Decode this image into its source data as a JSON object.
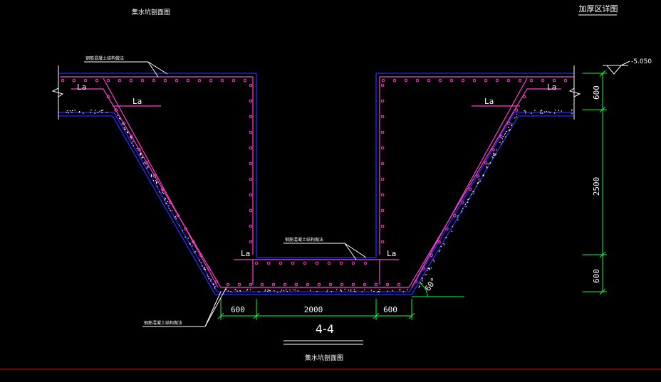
{
  "drawing": {
    "top_title": "集水坑剖面图",
    "corner_title": "加厚区详图",
    "section_label": "4-4",
    "bottom_title": "集水坑剖面图",
    "elevation": "-5.050",
    "callout_top": "钢筋混凝土结构做法",
    "callout_mid": "钢筋混凝土结构做法",
    "callout_bottom": "钢筋混凝土结构做法",
    "la_label": "La",
    "angle_label": "60°",
    "dims_horizontal": [
      "600",
      "2000",
      "600"
    ],
    "dims_vertical": [
      "600",
      "2500",
      "600"
    ]
  },
  "colors": {
    "background": "#000000",
    "rebar": "#ff3fd2",
    "concrete_outline": "#2a2aff",
    "dimension": "#00ff3c",
    "leader": "#ffffff",
    "frame": "#ff0000"
  }
}
